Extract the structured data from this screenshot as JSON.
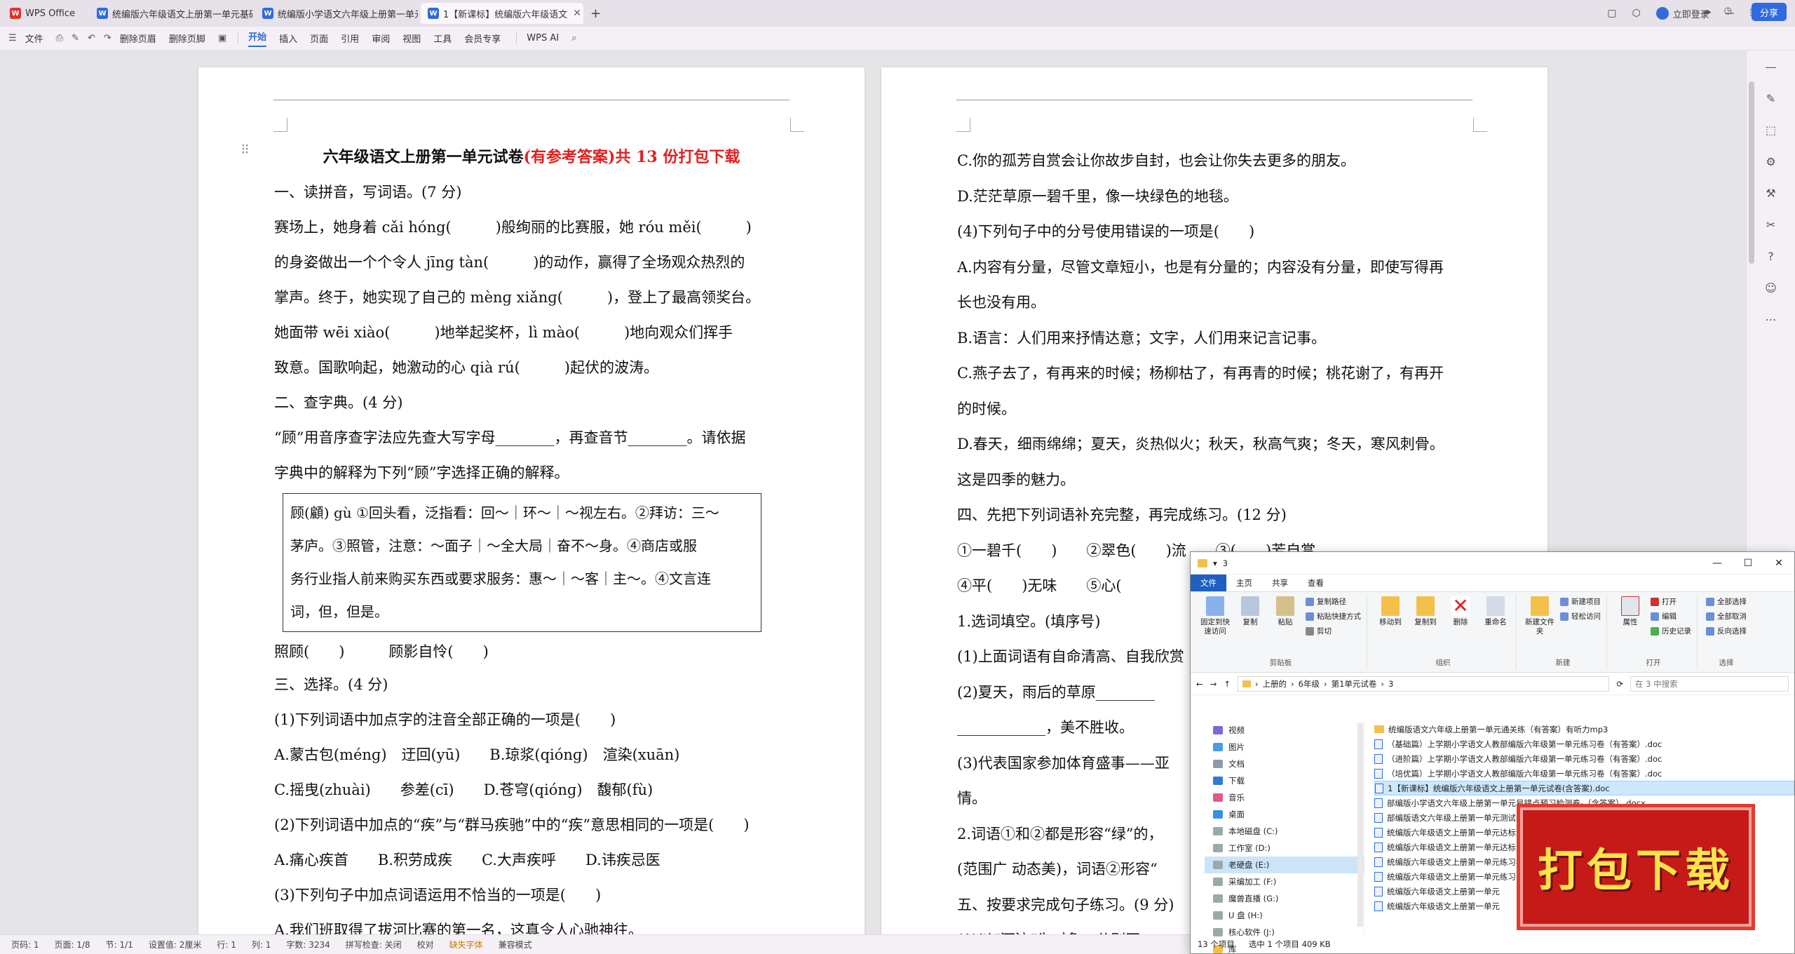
{
  "tabs": [
    {
      "label": "WPS Office",
      "type": "wps",
      "active": false
    },
    {
      "label": "统编版六年级语文上册第一单元基础",
      "type": "doc",
      "active": false
    },
    {
      "label": "统编版小学语文六年级上册第一单元",
      "type": "doc",
      "active": false
    },
    {
      "label": "1【新课标】统编版六年级语文",
      "type": "doc",
      "active": true
    }
  ],
  "tab_right": {
    "login": "立即登录"
  },
  "menu": {
    "file": "文件",
    "delete_header": "删除页眉",
    "delete_footer": "删除页脚",
    "items": [
      "开始",
      "插入",
      "页面",
      "引用",
      "审阅",
      "视图",
      "工具",
      "会员专享"
    ],
    "active": "开始",
    "ai": "WPS AI",
    "share": "分享"
  },
  "page1": {
    "title_black": "六年级语文上册第一单元试卷",
    "title_red": "(有参考答案)共 13 份打包下载",
    "lines_a": [
      "一、读拼音，写词语。(7 分)",
      "赛场上，她身着 cǎi hóng(　　　)般绚丽的比赛服，她 róu měi(　　　)",
      "的身姿做出一个个令人 jīng tàn(　　　)的动作，赢得了全场观众热烈的",
      "掌声。终于，她实现了自己的 mènɡ xiǎnɡ(　　　)，登上了最高领奖台。",
      "她面带 wēi xiào(　　　)地举起奖杯，lì mào(　　　)地向观众们挥手",
      "致意。国歌响起，她激动的心 qià rú(　　　)起伏的波涛。",
      "二、查字典。(4 分)",
      "“顾”用音序查字法应先查大写字母________，再查音节________。请依据",
      "字典中的解释为下列“顾”字选择正确的解释。"
    ],
    "dict_box": [
      "顾(顧) gù ①回头看，泛指看：回～｜环～｜～视左右。②拜访：三～",
      "茅庐。③照管，注意：～面子｜～全大局｜奋不～身。④商店或服",
      "务行业指人前来购买东西或要求服务：惠～｜～客｜主～。④文言连",
      "词，但，但是。"
    ],
    "lines_b": [
      "照顾(　　)　　　顾影自怜(　　)",
      "三、选择。(4 分)",
      "(1)下列词语中加点字的注音全部正确的一项是(　　)",
      "A.蒙古包(ménɡ)　迂回(yū)　　B.琼浆(qiónɡ)　渲染(xuān)",
      "C.摇曳(zhuài)　　参差(cī)　　D.苍穹(qiónɡ)　馥郁(fù)",
      "(2)下列词语中加点的“疾”与“群马疾驰”中的“疾”意思相同的一项是(　　)",
      "A.痛心疾首　　B.积劳成疾　　C.大声疾呼　　D.讳疾忌医",
      "(3)下列句子中加点词语运用不恰当的一项是(　　)",
      "A.我们班取得了拔河比赛的第一名，这真令人心驰神往。"
    ]
  },
  "page2": {
    "lines": [
      "C.你的孤芳自赏会让你故步自封，也会让你失去更多的朋友。",
      "D.茫茫草原一碧千里，像一块绿色的地毯。",
      "(4)下列句子中的分号使用错误的一项是(　　)",
      "A.内容有分量，尽管文章短小，也是有分量的；内容没有分量，即使写得再",
      "长也没有用。",
      "B.语言：人们用来抒情达意；文字，人们用来记言记事。",
      "C.燕子去了，有再来的时候；杨柳枯了，有再青的时候；桃花谢了，有再开",
      "的时候。",
      "D.春天，细雨绵绵；夏天，炎热似火；秋天，秋高气爽；冬天，寒风刺骨。",
      "这是四季的魅力。",
      "四、先把下列词语补充完整，再完成练习。(12 分)",
      "①一碧千(　　)　　②翠色(　　)流　　③(　　)芳自赏",
      "④平(　　)无味　　⑤心(",
      "1.选词填空。(填序号)",
      "(1)上面词语有自命清高、自我欣赏",
      "(2)夏天，雨后的草原________",
      "____________，美不胜收。",
      "(3)代表国家参加体育盛事——亚",
      "情。",
      "2.词语①和②都是形容“绿”的，",
      "(范围广 动态美)，词语②形容“",
      "五、按要求完成句子练习。(9 分)",
      "(1)以“河流”为对象，分别写一"
    ]
  },
  "statusbar": {
    "items": [
      "页码: 1",
      "页面: 1/8",
      "节: 1/1",
      "设置值: 2厘米",
      "行: 1",
      "列: 1",
      "字数: 3234",
      "拼写检查: 关闭",
      "校对"
    ],
    "warn": "缺失字体",
    "mode": "兼容模式"
  },
  "explorer": {
    "path_title": "3",
    "ribbon_tabs": [
      "文件",
      "主页",
      "共享",
      "查看"
    ],
    "clipboard": {
      "pin": "固定到快速访问",
      "copy": "复制",
      "paste": "粘贴",
      "copy_path": "复制路径",
      "paste_shortcut": "粘贴快捷方式",
      "cut": "剪切",
      "group": "剪贴板"
    },
    "organize": {
      "move": "移动到",
      "copyto": "复制到",
      "delete": "删除",
      "rename": "重命名",
      "group": "组织"
    },
    "new": {
      "folder": "新建文件夹",
      "item": "新建项目",
      "easy": "轻松访问",
      "group": "新建"
    },
    "open": {
      "props": "属性",
      "open": "打开",
      "edit": "编辑",
      "history": "历史记录",
      "group": "打开"
    },
    "select": {
      "all": "全部选择",
      "none": "全部取消",
      "invert": "反向选择",
      "group": "选择"
    },
    "breadcrumb": [
      "上册的",
      "6年级",
      "第1单元试卷",
      "3"
    ],
    "search_placeholder": "在 3 中搜索",
    "nav": [
      "视频",
      "图片",
      "文档",
      "下载",
      "音乐",
      "桌面",
      "本地磁盘 (C:)",
      "工作室 (D:)",
      "老硬盘 (E:)",
      "采编加工 (F:)",
      "魔兽直播 (G:)",
      "U 盘 (H:)",
      "核心软件 (J:)",
      "库"
    ],
    "nav_selected": "老硬盘 (E:)",
    "files": [
      {
        "name": "统编版语文六年级上册第一单元通关练（有答案）有听力mp3",
        "folder": true
      },
      {
        "name": "（基础篇）上学期小学语文人教部编版六年级第一单元练习卷（有答案）.doc",
        "folder": false
      },
      {
        "name": "（进阶篇）上学期小学语文人教部编版六年级第一单元练习卷（有答案）.doc",
        "folder": false
      },
      {
        "name": "（培优篇）上学期小学语文人教部编版六年级第一单元练习卷（有答案）.doc",
        "folder": false
      },
      {
        "name": "1【新课标】统编版六年级语文上册第一单元试卷(含答案).doc",
        "folder": false,
        "selected": true
      },
      {
        "name": "部编版小学语文六年级上册第一单元易错点预习检测卷-（含答案）.docx",
        "folder": false
      },
      {
        "name": "部编版语文六年级上册第一单元测试卷（含答案）.docx",
        "folder": false
      },
      {
        "name": "统编版六年级语文上册第一单元达标测试（含答案）(0001).doc",
        "folder": false
      },
      {
        "name": "统编版六年级语文上册第一单元达标测试（含答案）(0002).doc",
        "folder": false
      },
      {
        "name": "统编版六年级语文上册第一单元练习卷（含答案）.doc",
        "folder": false
      },
      {
        "name": "统编版六年级语文上册第一单元练习卷",
        "folder": false
      },
      {
        "name": "统编版六年级语文上册第一单元",
        "folder": false
      },
      {
        "name": "统编版六年级语文上册第一单元",
        "folder": false
      }
    ],
    "status": {
      "count": "13 个项目",
      "selected": "选中 1 个项目  409 KB"
    }
  },
  "promo": {
    "text": "打包下载"
  }
}
